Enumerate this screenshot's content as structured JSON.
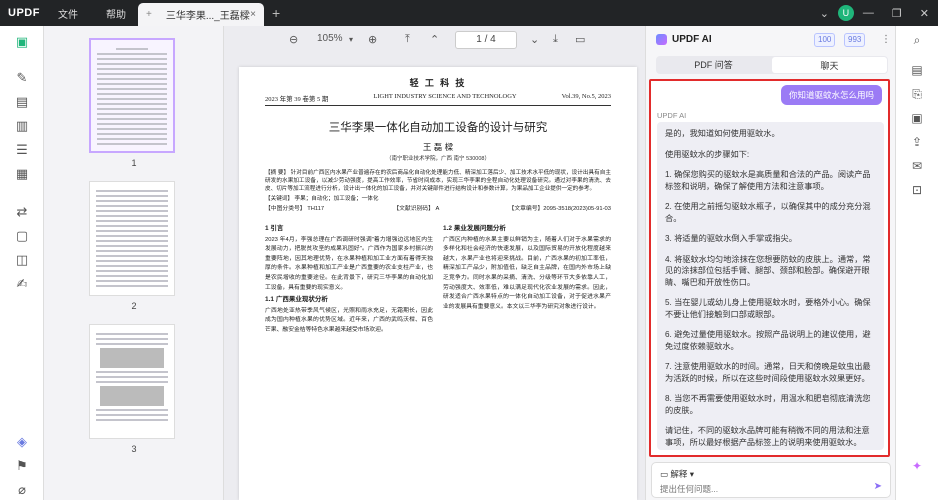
{
  "titlebar": {
    "logo": "UPDF",
    "menu": [
      "文件",
      "帮助"
    ],
    "tab_title": "三华李果..._王磊樑",
    "tab_plus": "+",
    "tab_close": "×",
    "new_tab": "+",
    "avatar_letter": "U",
    "accent": "#1fb57a"
  },
  "toolbar": {
    "zoom": "105%",
    "page_current": "1",
    "page_total": "4",
    "page_display": "1 / 4"
  },
  "thumbnails": {
    "labels": [
      "1",
      "2",
      "3"
    ]
  },
  "document": {
    "journal": "轻 工 科 技",
    "issue_left": "2023 年第 39 卷第 5 期",
    "issue_mid": "LIGHT INDUSTRY SCIENCE AND TECHNOLOGY",
    "issue_right": "Vol.39, No.5, 2023",
    "title": "三华李果一体化自动加工设备的设计与研究",
    "author": "王 磊 樑",
    "affiliation": "（南宁职业技术学院，广西  南宁  530008）",
    "abstract": "【摘  要】 针对目前广西区内水果产业普遍存在的农后商品化自动化处理能力低、精深加工落后少、加工技术水平低的现状，设计出具有自主研发的水果加工设备，以减少劳动强度，提高工作效率，节省时间成本，实现三华李果的全程自动化处理设备研究。通过对李果的清洗、去皮、切片等加工流程进行分析，设计出一体化的加工设备，并对关键部件进行结构设计和参数计算，为果品加工企业提供一定的参考。",
    "keywords": "【关键词】 李果；自动化；加工设备；一体化",
    "class_no": "【中图分类号】 TH117",
    "doc_code": "【文献识别码】 A",
    "article_no": "【文章编号】2095-3518(2023)05-91-03",
    "sec1": "1  引言",
    "col1": "2023 年4月，李强总理在广西调研时强调\"着力增强边远地区内生发展动力，把脱贫攻坚的成果巩固好\"。广西作为国家乡村振兴的重要阵地，因其地理优势，在水果种植和加工业方面有着得天独厚的条件。水果种植和加工产业是广西重要的农业支柱产业，也是农民增收的重要途径。在此背景下，研究三华李果的自动化加工设备，具有重要的现实意义。",
    "sec1_1": "1.1  广西果业现状分析",
    "col1b": "广西地处亚热带季风气候区，光照和雨水充足，无霜期长，因此成为国内种植水果的优势区域。近年来，广西的武鸣沃柑、百色芒果、融安金桔等特色水果越来越受市场欢迎。",
    "sec1_2": "1.2  果业发展问题分析",
    "col2": "广西区内种植的水果主要以鲜销为主，随着人们对于水果需求的多样化和社会经济的快速发展，以及国际贸易的开放化程度越来越大，水果产业也将迎来挑战。目前，广西水果的初加工率低，精深加工产品少，附加值低，缺乏自主品牌，在国内外市场上缺乏竞争力。同时水果的采摘、清洗、分级等环节大多依靠人工，劳动强度大、效率低，难以满足现代化农业发展的需求。因此，研发适合广西水果特点的一体化自动加工设备，对于促进水果产业的发展具有重要意义。本文以三华李为研究对象进行设计。"
  },
  "ai_panel": {
    "title": "UPDF AI",
    "badge1": "100",
    "badge2": "993",
    "tab_pdf": "PDF 问答",
    "tab_chat": "聊天",
    "question": "你知道驱蚊水怎么用吗",
    "ai_label": "UPDF AI",
    "answer": [
      "是的，我知道如何使用驱蚊水。",
      "使用驱蚊水的步骤如下:",
      "1. 确保您购买的驱蚊水是高质量和合法的产品。阅读产品标签和说明，确保了解使用方法和注意事项。",
      "2. 在使用之前摇匀驱蚊水瓶子，以确保其中的成分充分混合。",
      "3. 将适量的驱蚊水倒入手掌或指尖。",
      "4. 将驱蚊水均匀地涂抹在您想要防蚊的皮肤上。通常，常见的涂抹部位包括手臂、腿部、颈部和脸部。确保避开眼睛、嘴巴和开放性伤口。",
      "5. 当在婴儿或幼儿身上使用驱蚊水时，要格外小心。确保不要让他们接触到口部或眼部。",
      "6. 避免过量使用驱蚊水。按照产品说明上的建议使用，避免过度依赖驱蚊水。",
      "7. 注意使用驱蚊水的时间。通常，日天和傍晚是蚊虫出最为活跃的时候，所以在这些时间段使用驱蚊水效果更好。",
      "8. 当您不再需要使用驱蚊水时，用温水和肥皂彻底清洗您的皮肤。",
      "请记住，不同的驱蚊水品牌可能有稍微不同的用法和注意事项，所以最好根据产品标签上的说明来使用驱蚊水。"
    ],
    "explain_label": "解释",
    "input_placeholder": "提出任何问题...",
    "highlight_color": "#e22b2b",
    "bubble_color": "#9b7bf5"
  }
}
